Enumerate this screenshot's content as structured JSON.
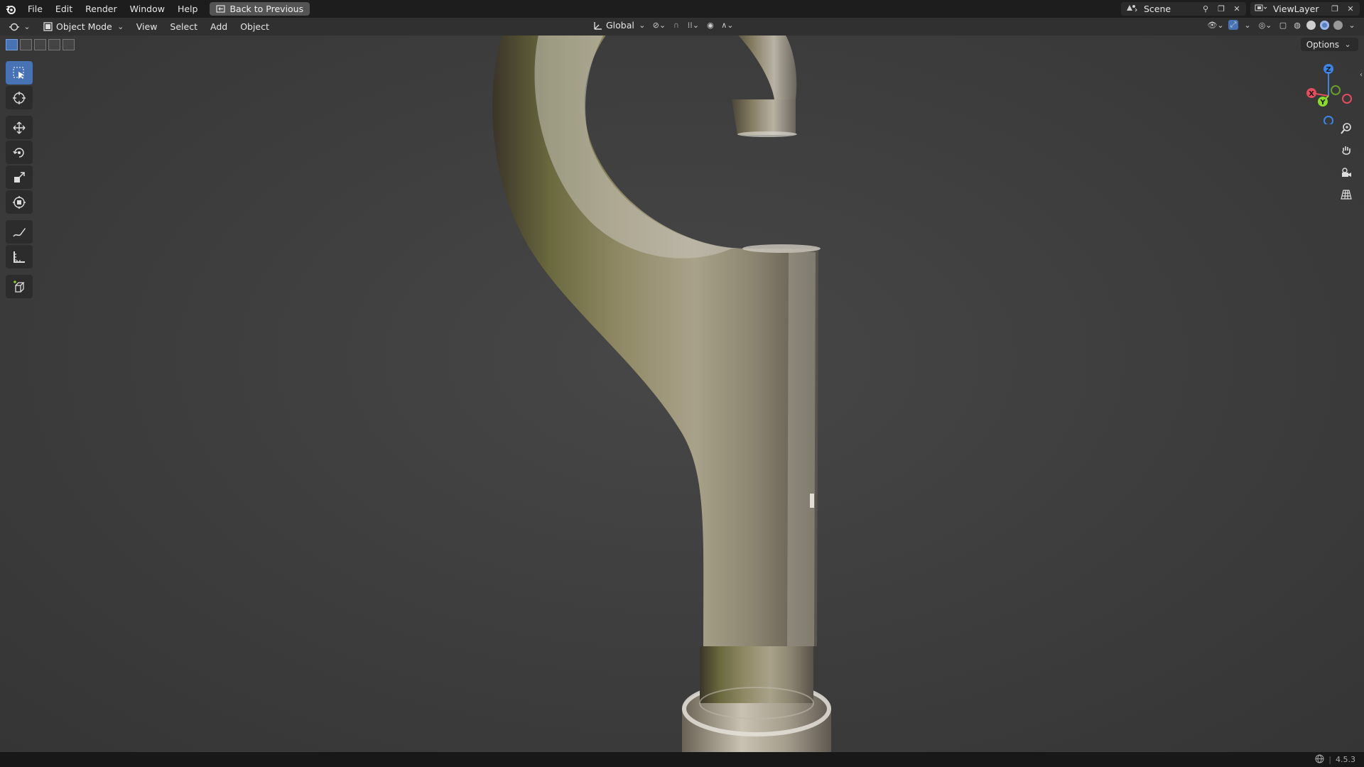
{
  "menu": {
    "items": [
      "File",
      "Edit",
      "Render",
      "Window",
      "Help"
    ],
    "back_button": "Back to Previous"
  },
  "top_right": {
    "scene_name": "Scene",
    "view_layer_name": "ViewLayer"
  },
  "header": {
    "mode": "Object Mode",
    "menus": [
      "View",
      "Select",
      "Add",
      "Object"
    ],
    "transform_orientation": "Global"
  },
  "viewport": {
    "options_label": "Options",
    "gizmo_axes": {
      "x": "X",
      "y": "Y",
      "z": "Z"
    }
  },
  "toolbar": {
    "tools": [
      "select-box",
      "cursor",
      "move",
      "rotate",
      "scale",
      "transform",
      "annotate",
      "measure",
      "add-cube"
    ],
    "active": "select-box"
  },
  "status": {
    "version": "4.5.3"
  },
  "colors": {
    "accent": "#4772b3",
    "axis_x": "#e44d5f",
    "axis_y": "#8bd92b",
    "axis_z": "#3f84e5"
  }
}
